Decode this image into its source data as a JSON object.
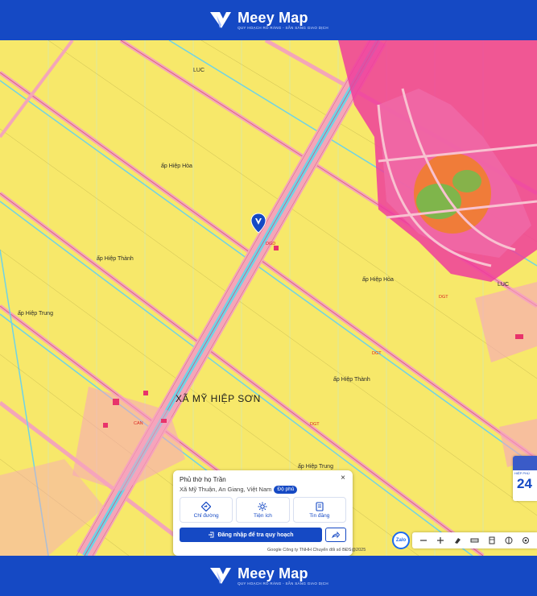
{
  "brand": {
    "name": "Meey Map",
    "tagline": "QUY HOẠCH RÕ RÀNG - SẴN SÀNG GIAO DỊCH"
  },
  "map": {
    "labels": {
      "ap_hiep_hoa_1": "ấp Hiệp Hòa",
      "ap_hiep_thanh_1": "ấp Hiệp Thành",
      "ap_hiep_trung_1": "ấp Hiệp Trung",
      "ap_hiep_hoa_2": "ấp Hiệp Hòa",
      "ap_hiep_thanh_2": "ấp Hiệp Thành",
      "ap_hiep_trung_2": "ấp Hiệp Trung",
      "commune": "XÃ MỸ HIỆP SƠN",
      "dgd": "DGD",
      "dgt_1": "DGT",
      "dgt_2": "DGT",
      "dgt_3": "DGT",
      "can": "CAN",
      "luc_1": "LUC",
      "luc_2": "LUC"
    }
  },
  "popup": {
    "title": "Phủ thờ họ Trần",
    "address": "Xã Mỹ Thuận, An Giang, Việt Nam",
    "badge": "Độ phủ",
    "close": "×",
    "actions": [
      {
        "label": "Chỉ đường"
      },
      {
        "label": "Tiện ích"
      },
      {
        "label": "Tin đăng"
      }
    ],
    "login_label": "Đăng nhập để tra quy hoạch"
  },
  "google_attr": "Google  Công ty TNHH Chuyển đổi số BĐS@2025",
  "zalo_label": "Zalo",
  "side_card": {
    "sub": "HIỆP PHÚ",
    "number": "24"
  },
  "colors": {
    "brand_blue": "#1549c4",
    "land_yellow": "#f7e86a",
    "road_pink": "#f4a6b8",
    "canal_cyan": "#6fd3e6",
    "urban_magenta": "#ee3d9b",
    "park_orange": "#f07e2d"
  }
}
